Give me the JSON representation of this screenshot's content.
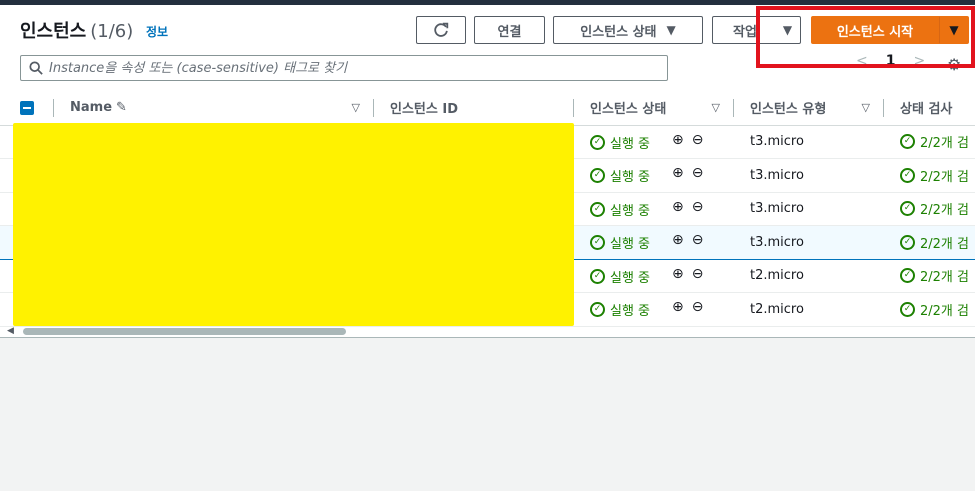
{
  "header": {
    "title": "인스턴스",
    "count": "(1/6)",
    "info": "정보"
  },
  "toolbar": {
    "refresh_icon": "refresh-icon",
    "connect": "연결",
    "instance_state": "인스턴스 상태",
    "actions": "작업",
    "launch": "인스턴스 시작",
    "caret": "▼"
  },
  "search": {
    "placeholder": "Instance을 속성 또는 (case-sensitive) 태그로 찾기"
  },
  "pagination": {
    "prev": "<",
    "page": "1",
    "next": ">"
  },
  "table": {
    "columns": [
      "Name",
      "인스턴스 ID",
      "인스턴스 상태",
      "인스턴스 유형",
      "상태 검사"
    ],
    "rows": [
      {
        "state": "실행 중",
        "type": "t3.micro",
        "check": "2/2개 검"
      },
      {
        "state": "실행 중",
        "type": "t3.micro",
        "check": "2/2개 검"
      },
      {
        "state": "실행 중",
        "type": "t3.micro",
        "check": "2/2개 검"
      },
      {
        "state": "실행 중",
        "type": "t3.micro",
        "check": "2/2개 검"
      },
      {
        "state": "실행 중",
        "type": "t2.micro",
        "check": "2/2개 검"
      },
      {
        "state": "실행 중",
        "type": "t2.micro",
        "check": "2/2개 검"
      }
    ],
    "selected_row": 3
  },
  "colors": {
    "primary": "#ec7211",
    "success": "#1d8102",
    "link": "#0073bb",
    "highlight": "#e2131d",
    "redaction": "#fff200"
  }
}
